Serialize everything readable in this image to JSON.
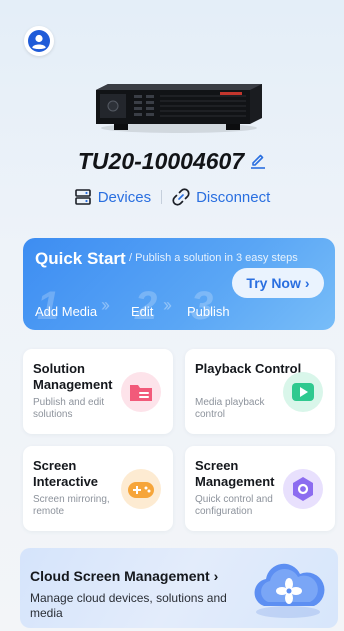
{
  "device": {
    "name": "TU20-10004607"
  },
  "actions": {
    "devices_label": "Devices",
    "disconnect_label": "Disconnect"
  },
  "quick_start": {
    "title": "Quick Start",
    "subtitle": "/ Publish a solution in 3 easy steps",
    "try_label": "Try Now",
    "steps": [
      {
        "num": "1",
        "label": "Add Media"
      },
      {
        "num": "2",
        "label": "Edit"
      },
      {
        "num": "3",
        "label": "Publish"
      }
    ]
  },
  "cards": [
    {
      "title": "Solution Management",
      "subtitle": "Publish and edit solutions",
      "icon": "folder-icon",
      "color": "#f25a7a"
    },
    {
      "title": "Playback Control",
      "subtitle": "Media playback control",
      "icon": "play-icon",
      "color": "#2fc98f"
    },
    {
      "title": "Screen Interactive",
      "subtitle": "Screen mirroring, remote",
      "icon": "gamepad-icon",
      "color": "#f6a53a"
    },
    {
      "title": "Screen Management",
      "subtitle": "Quick control and configuration",
      "icon": "hexagon-icon",
      "color": "#8c6cf0"
    }
  ],
  "cloud": {
    "title": "Cloud Screen Management",
    "subtitle": "Manage cloud devices, solutions and media",
    "icon": "cloud-icon"
  },
  "colors": {
    "accent": "#2a6fe0",
    "quick_start_bg": "#4a97f3"
  }
}
